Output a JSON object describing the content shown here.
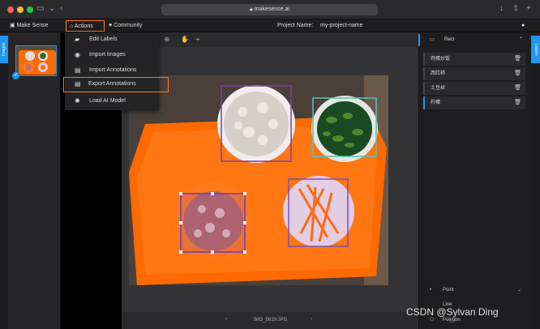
{
  "browser": {
    "url": "makesense.ai",
    "lock_icon": "lock-icon"
  },
  "header": {
    "brand": "Make Sense",
    "actions_label": "Actions",
    "community_label": "Community",
    "project_label": "Project Name:",
    "project_value": "my-project-name"
  },
  "left_tab": "Images",
  "right_tab": "Labels",
  "actions_menu": {
    "items": [
      {
        "label": "Edit Labels",
        "icon": "tag-icon"
      },
      {
        "label": "Import Images",
        "icon": "camera-icon"
      },
      {
        "label": "Import Annotations",
        "icon": "file-import-icon"
      },
      {
        "label": "Export Annotations",
        "icon": "file-export-icon",
        "highlighted": true
      },
      {
        "label": "Load AI Model",
        "icon": "ai-icon"
      }
    ]
  },
  "labels_panel": {
    "title": "Rect",
    "labels": [
      "鸡蛋炒饭",
      "西红柿",
      "土豆丝",
      "柠檬"
    ],
    "active_index": 3,
    "sections": [
      "Point",
      "Line",
      "Polygon"
    ]
  },
  "editor": {
    "image_name": "IMG_9619.JPG"
  },
  "watermark": "CSDN @Sylvan Ding",
  "colors": {
    "accent": "#2196f3",
    "highlight": "#ff7a18",
    "tray": "#ff6a00"
  }
}
